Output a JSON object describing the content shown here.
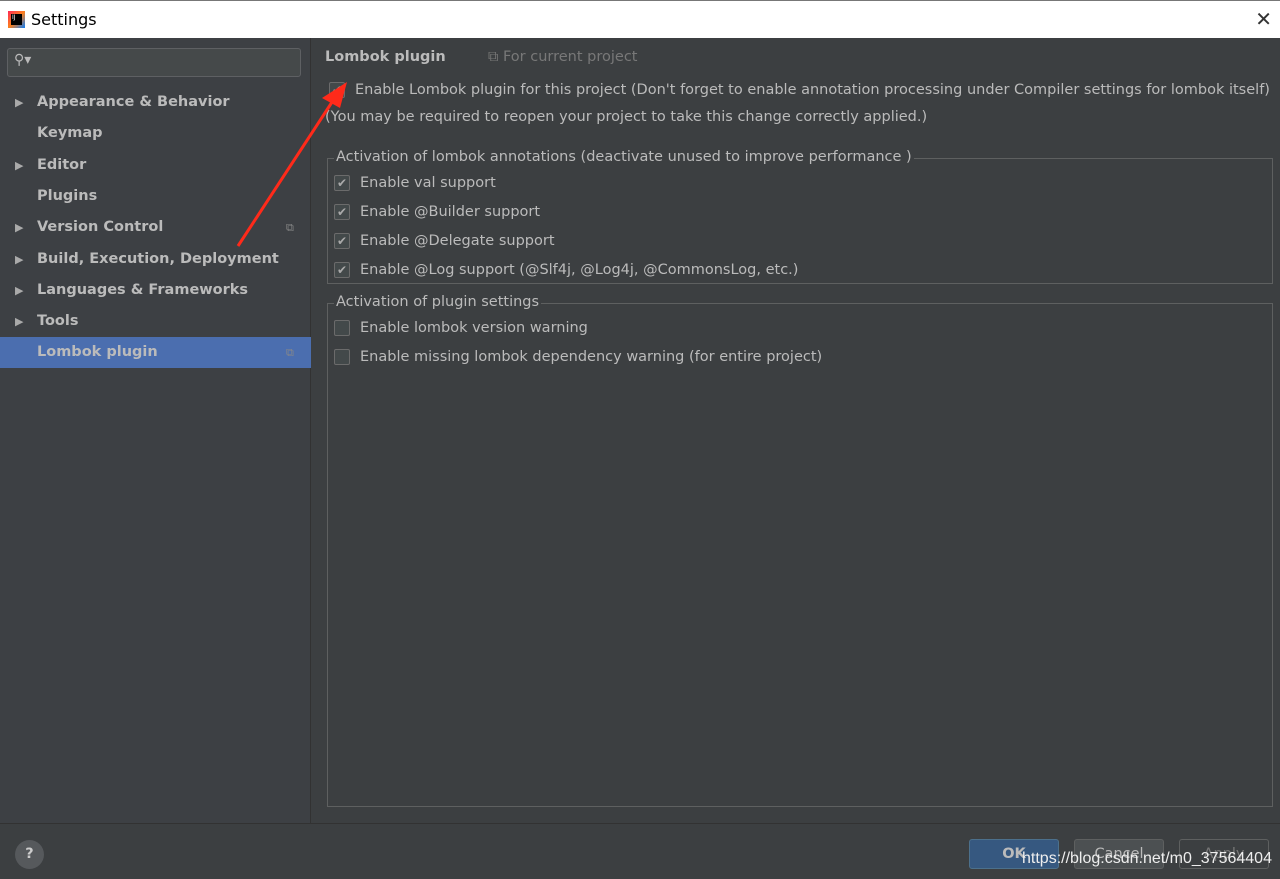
{
  "window": {
    "title": "Settings",
    "close": "✕"
  },
  "sidebar": {
    "search_placeholder": "",
    "items": [
      {
        "label": "Appearance & Behavior",
        "expandable": true
      },
      {
        "label": "Keymap",
        "expandable": false
      },
      {
        "label": "Editor",
        "expandable": true
      },
      {
        "label": "Plugins",
        "expandable": false
      },
      {
        "label": "Version Control",
        "expandable": true,
        "project_icon": true
      },
      {
        "label": "Build, Execution, Deployment",
        "expandable": true
      },
      {
        "label": "Languages & Frameworks",
        "expandable": true
      },
      {
        "label": "Tools",
        "expandable": true
      },
      {
        "label": "Lombok plugin",
        "expandable": false,
        "selected": true,
        "project_icon": true
      }
    ]
  },
  "main": {
    "header": "Lombok plugin",
    "scope": "For current project",
    "enable_plugin": {
      "label": "Enable Lombok plugin for this project (Don't forget to enable annotation processing under Compiler settings for lombok itself)",
      "checked": true
    },
    "note": "(You may be required to reopen your project to take this change correctly applied.)",
    "group1": {
      "title": "Activation of lombok annotations (deactivate unused to improve performance )",
      "options": [
        {
          "label": "Enable val support",
          "checked": true
        },
        {
          "label": "Enable @Builder support",
          "checked": true
        },
        {
          "label": "Enable @Delegate support",
          "checked": true
        },
        {
          "label": "Enable @Log support (@Slf4j, @Log4j, @CommonsLog, etc.)",
          "checked": true
        }
      ]
    },
    "group2": {
      "title": "Activation of plugin settings",
      "options": [
        {
          "label": "Enable lombok version warning",
          "checked": false
        },
        {
          "label": "Enable missing lombok dependency warning (for entire project)",
          "checked": false
        }
      ]
    }
  },
  "footer": {
    "help": "?",
    "ok": "OK",
    "cancel": "Cancel",
    "apply": "Apply",
    "watermark": "https://blog.csdn.net/m0_37564404"
  },
  "colors": {
    "selection": "#4b6eaf",
    "annotation_arrow": "#ff2a1a"
  }
}
